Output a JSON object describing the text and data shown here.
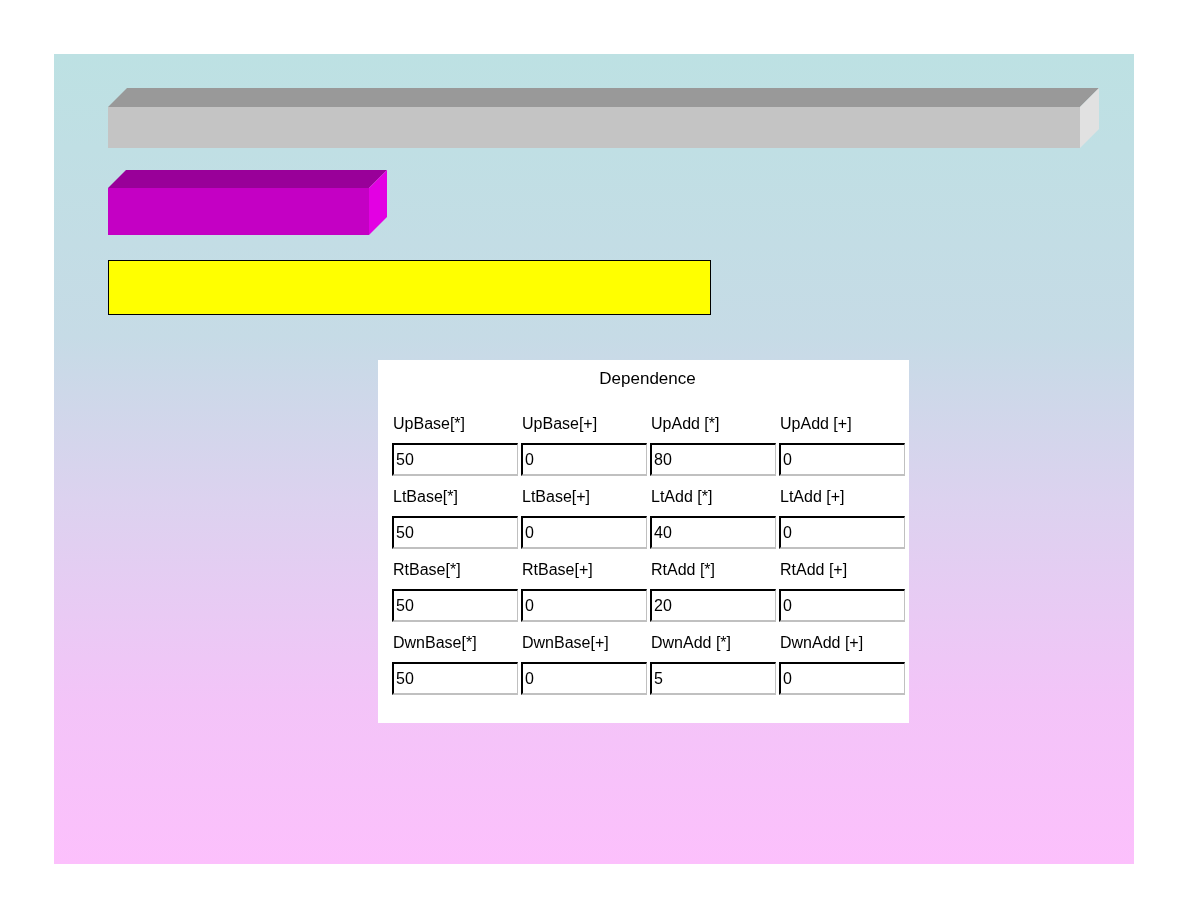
{
  "panel": {
    "title": "Dependence",
    "rows": [
      [
        {
          "label": "UpBase[*]",
          "value": "50"
        },
        {
          "label": "UpBase[+]",
          "value": "0"
        },
        {
          "label": "UpAdd [*]",
          "value": "80"
        },
        {
          "label": "UpAdd [+]",
          "value": "0"
        }
      ],
      [
        {
          "label": "LtBase[*]",
          "value": "50"
        },
        {
          "label": "LtBase[+]",
          "value": "0"
        },
        {
          "label": "LtAdd [*]",
          "value": "40"
        },
        {
          "label": "LtAdd [+]",
          "value": "0"
        }
      ],
      [
        {
          "label": "RtBase[*]",
          "value": "50"
        },
        {
          "label": "RtBase[+]",
          "value": "0"
        },
        {
          "label": "RtAdd [*]",
          "value": "20"
        },
        {
          "label": "RtAdd [+]",
          "value": "0"
        }
      ],
      [
        {
          "label": "DwnBase[*]",
          "value": "50"
        },
        {
          "label": "DwnBase[+]",
          "value": "0"
        },
        {
          "label": "DwnAdd [*]",
          "value": "5"
        },
        {
          "label": "DwnAdd [+]",
          "value": "0"
        }
      ]
    ]
  }
}
